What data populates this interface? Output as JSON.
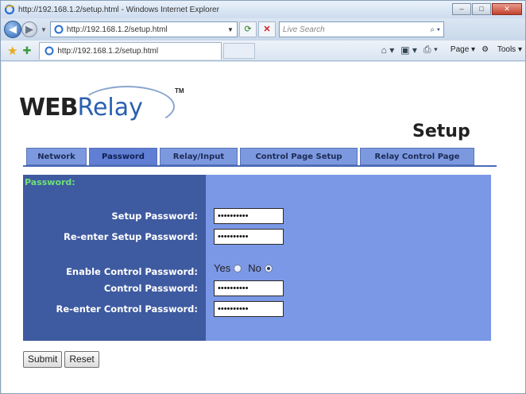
{
  "window": {
    "title": "http://192.168.1.2/setup.html - Windows Internet Explorer"
  },
  "address_bar": {
    "url": "http://192.168.1.2/setup.html"
  },
  "search": {
    "placeholder": "Live Search"
  },
  "tab": {
    "label": "http://192.168.1.2/setup.html"
  },
  "command_bar": {
    "page_label": "Page",
    "tools_label": "Tools"
  },
  "logo": {
    "web": "WEB",
    "relay": "Relay",
    "tm": "TM"
  },
  "page": {
    "title": "Setup"
  },
  "nav_tabs": [
    {
      "label": "Network"
    },
    {
      "label": "Password"
    },
    {
      "label": "Relay/Input"
    },
    {
      "label": "Control Page Setup"
    },
    {
      "label": "Relay Control Page"
    }
  ],
  "form": {
    "section_title": "Password:",
    "setup_password_label": "Setup Password:",
    "setup_password_value": "••••••••••",
    "reenter_setup_label": "Re-enter Setup Password:",
    "reenter_setup_value": "••••••••••",
    "enable_control_label": "Enable Control Password:",
    "yes_label": "Yes",
    "no_label": "No",
    "enable_control_selected": "No",
    "control_password_label": "Control Password:",
    "control_password_value": "••••••••••",
    "reenter_control_label": "Re-enter Control Password:",
    "reenter_control_value": "••••••••••"
  },
  "buttons": {
    "submit": "Submit",
    "reset": "Reset"
  },
  "colors": {
    "panel_dark": "#3e5aa0",
    "panel_light": "#7b98e6",
    "tab_bg": "#7c99e0",
    "section_title": "#6fe07a"
  }
}
